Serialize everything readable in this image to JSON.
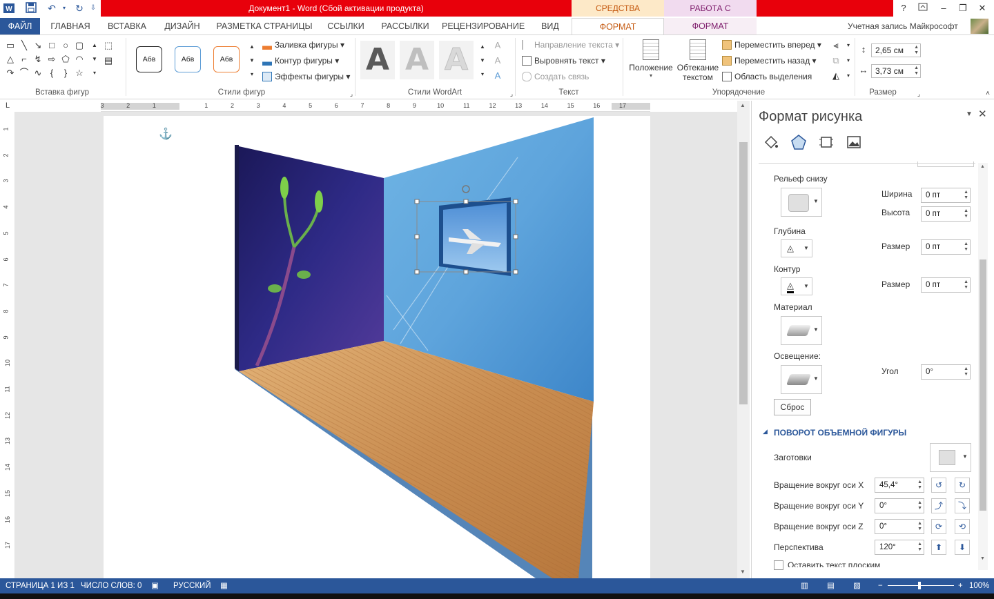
{
  "titlebar": {
    "title": "Документ1 -  Word (Сбой активации продукта)",
    "context_drawing": "СРЕДСТВА РИСОВАНИЯ",
    "context_picture": "РАБОТА С РИСУНКАМИ",
    "help": "?"
  },
  "tabs": {
    "file": "ФАЙЛ",
    "items": [
      "ГЛАВНАЯ",
      "ВСТАВКА",
      "ДИЗАЙН",
      "РАЗМЕТКА СТРАНИЦЫ",
      "ССЫЛКИ",
      "РАССЫЛКИ",
      "РЕЦЕНЗИРОВАНИЕ",
      "ВИД"
    ],
    "format_drawing": "ФОРМАТ",
    "format_picture": "ФОРМАТ",
    "account": "Учетная запись Майкрософт"
  },
  "ribbon": {
    "groups": {
      "insert_shapes": "Вставка фигур",
      "shape_styles": "Стили фигур",
      "wordart_styles": "Стили WordArt",
      "text": "Текст",
      "arrange": "Упорядочение",
      "size": "Размер"
    },
    "style_sample": "Абв",
    "shape_fill": "Заливка фигуры",
    "shape_outline": "Контур фигуры",
    "shape_effects": "Эффекты фигуры",
    "wordart_letter": "A",
    "text_direction": "Направление текста",
    "align_text": "Выровнять текст",
    "create_link": "Создать связь",
    "position": "Положение",
    "wrap_text_1": "Обтекание",
    "wrap_text_2": "текстом",
    "bring_forward": "Переместить вперед",
    "send_backward": "Переместить назад",
    "selection_pane": "Область выделения",
    "height": "2,65 см",
    "width": "3,73 см"
  },
  "pane": {
    "title": "Формат рисунка",
    "bevel_bottom": "Рельеф снизу",
    "width_label": "Ширина",
    "width_value": "0 пт",
    "height_label": "Высота",
    "height_value": "0 пт",
    "depth": "Глубина",
    "depth_size_label": "Размер",
    "depth_size_value": "0 пт",
    "contour": "Контур",
    "contour_size_label": "Размер",
    "contour_size_value": "0 пт",
    "material": "Материал",
    "lighting": "Освещение:",
    "angle_label": "Угол",
    "angle_value": "0°",
    "reset": "Сброс",
    "rotation_header": "ПОВОРОТ ОБЪЕМНОЙ ФИГУРЫ",
    "presets": "Заготовки",
    "x_rotation_label": "Вращение вокруг оси X",
    "x_rotation_value": "45,4°",
    "y_rotation_label": "Вращение вокруг оси Y",
    "y_rotation_value": "0°",
    "z_rotation_label": "Вращение вокруг оси Z",
    "z_rotation_value": "0°",
    "perspective_label": "Перспектива",
    "perspective_value": "120°",
    "keep_text_flat": "Оставить текст плоским"
  },
  "ruler": {
    "h_numbers": [
      "3",
      "2",
      "1",
      "",
      "1",
      "2",
      "3",
      "4",
      "5",
      "6",
      "7",
      "8",
      "9",
      "10",
      "11",
      "12",
      "13",
      "14",
      "15",
      "16",
      "17"
    ],
    "v_numbers": [
      "1",
      "2",
      "3",
      "4",
      "5",
      "6",
      "7",
      "8",
      "9",
      "10",
      "11",
      "12",
      "13",
      "14",
      "15",
      "16",
      "17"
    ],
    "corner": "L"
  },
  "status": {
    "page": "СТРАНИЦА 1 ИЗ 1",
    "words": "ЧИСЛО СЛОВ: 0",
    "language": "РУССКИЙ",
    "zoom": "100%",
    "zoom_minus": "−",
    "zoom_plus": "+"
  },
  "colors": {
    "accent": "#2b579a",
    "title_red": "#e8000b",
    "drawing_ctx": "#c55a11",
    "picture_ctx": "#7e1d6c"
  }
}
